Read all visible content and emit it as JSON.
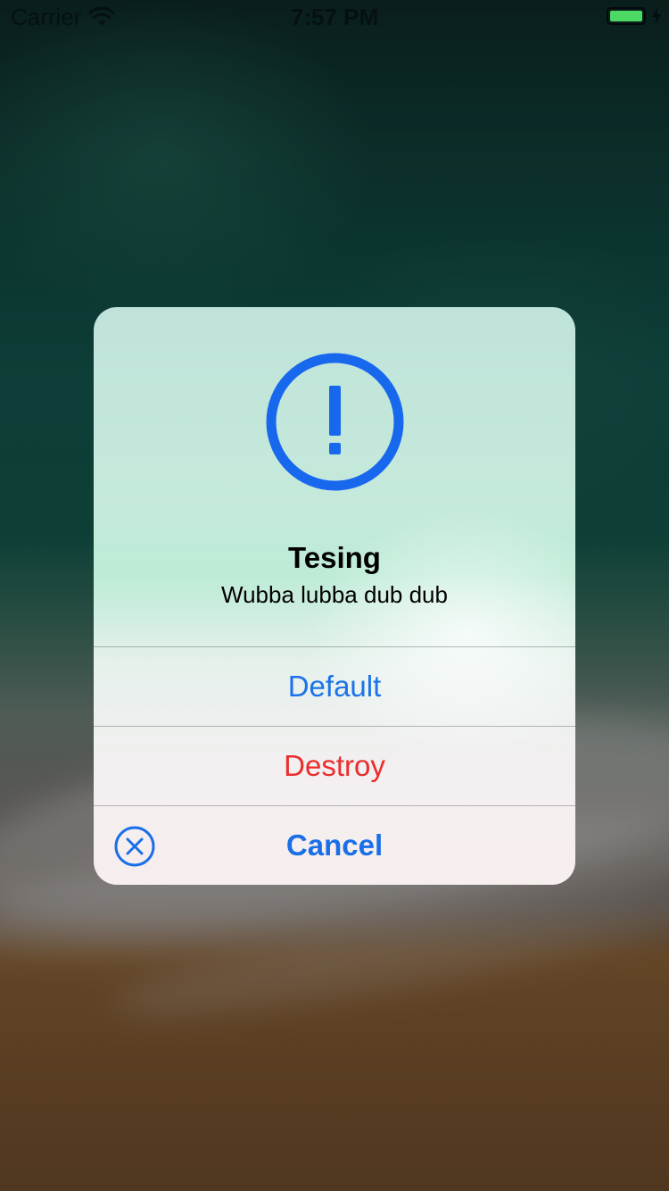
{
  "status_bar": {
    "carrier": "Carrier",
    "time": "7:57 PM",
    "icons": [
      "wifi-icon",
      "battery-icon",
      "charging-bolt-icon"
    ],
    "battery_color": "#4cd964"
  },
  "alert": {
    "icon": "exclamation-circle-icon",
    "title": "Tesing",
    "message": "Wubba lubba dub dub",
    "actions": [
      {
        "label": "Default",
        "style": "default",
        "color": "#1a73e8"
      },
      {
        "label": "Destroy",
        "style": "destructive",
        "color": "#ea2d2d"
      },
      {
        "label": "Cancel",
        "style": "cancel",
        "color": "#1a6fe8",
        "icon": "close-circle-icon"
      }
    ],
    "accent_color": "#1868ee"
  }
}
